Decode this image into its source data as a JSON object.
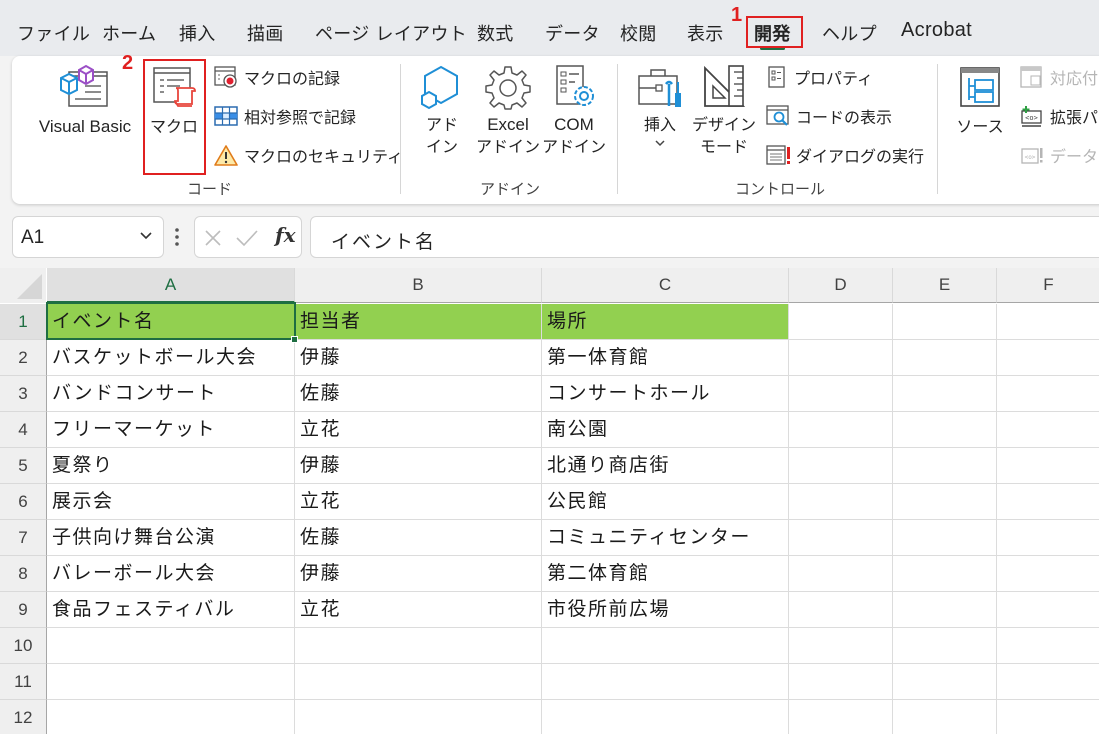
{
  "menu": {
    "tabs": [
      {
        "label": "ファイル"
      },
      {
        "label": "ホーム"
      },
      {
        "label": "挿入"
      },
      {
        "label": "描画"
      },
      {
        "label": "ページ レイアウト"
      },
      {
        "label": "数式"
      },
      {
        "label": "データ"
      },
      {
        "label": "校閲"
      },
      {
        "label": "表示"
      },
      {
        "label": "開発",
        "active": true
      },
      {
        "label": "ヘルプ"
      },
      {
        "label": "Acrobat"
      }
    ]
  },
  "annotations": {
    "step1": "1",
    "step2": "2",
    "highlight_color": "#e02020"
  },
  "ribbon": {
    "groups": {
      "code": {
        "label": "コード",
        "visual_basic": "Visual Basic",
        "macro": "マクロ",
        "record_macro": "マクロの記録",
        "relative_ref": "相対参照で記録",
        "macro_security": "マクロのセキュリティ"
      },
      "addins": {
        "label": "アドイン",
        "addin_line1": "アド",
        "addin_line2": "イン",
        "excel_addin_line1": "Excel",
        "excel_addin_line2": "アドイン",
        "com_addin_line1": "COM",
        "com_addin_line2": "アドイン"
      },
      "controls": {
        "label": "コントロール",
        "insert": "挿入",
        "design_mode_line1": "デザイン",
        "design_mode_line2": "モード",
        "properties": "プロパティ",
        "view_code": "コードの表示",
        "run_dialog": "ダイアログの実行"
      },
      "xml": {
        "source": "ソース",
        "map_properties": "対応付",
        "expansion_packs": "拡張パ",
        "refresh_data": "データの"
      }
    }
  },
  "formula_bar": {
    "name_box": "A1",
    "formula": "イベント名",
    "fx_label": "fx"
  },
  "sheet": {
    "columns": [
      "A",
      "B",
      "C",
      "D",
      "E",
      "F"
    ],
    "row_numbers": [
      "1",
      "2",
      "3",
      "4",
      "5",
      "6",
      "7",
      "8",
      "9",
      "10",
      "11",
      "12"
    ],
    "header_fill": "#92d050",
    "rows": [
      [
        "イベント名",
        "担当者",
        "場所"
      ],
      [
        "バスケットボール大会",
        "伊藤",
        "第一体育館"
      ],
      [
        "バンドコンサート",
        "佐藤",
        "コンサートホール"
      ],
      [
        "フリーマーケット",
        "立花",
        "南公園"
      ],
      [
        "夏祭り",
        "伊藤",
        "北通り商店街"
      ],
      [
        "展示会",
        "立花",
        "公民館"
      ],
      [
        "子供向け舞台公演",
        "佐藤",
        "コミュニティセンター"
      ],
      [
        "バレーボール大会",
        "伊藤",
        "第二体育館"
      ],
      [
        "食品フェスティバル",
        "立花",
        "市役所前広場"
      ],
      [
        "",
        "",
        ""
      ],
      [
        "",
        "",
        ""
      ],
      [
        "",
        "",
        ""
      ]
    ],
    "selected_cell": "A1"
  }
}
